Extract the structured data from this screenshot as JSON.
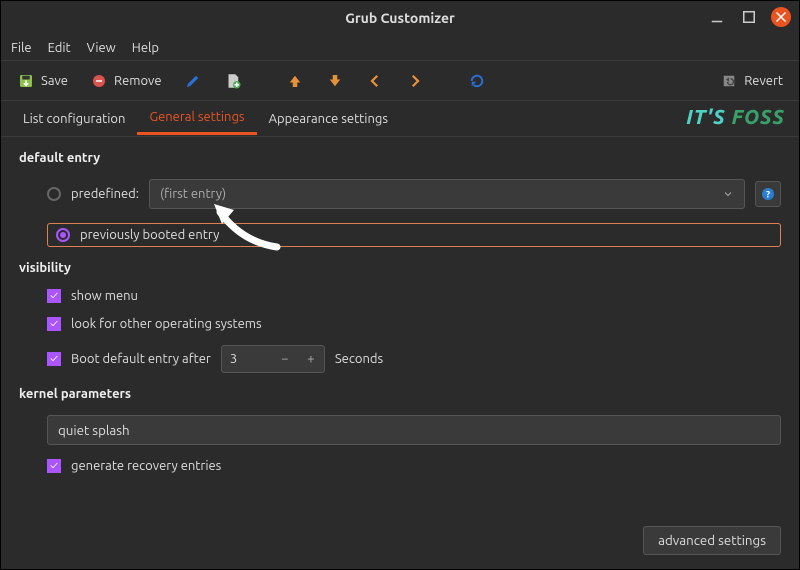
{
  "window": {
    "title": "Grub Customizer"
  },
  "menubar": [
    "File",
    "Edit",
    "View",
    "Help"
  ],
  "toolbar": {
    "save": "Save",
    "remove": "Remove",
    "revert": "Revert"
  },
  "tabs": {
    "list": "List configuration",
    "general": "General settings",
    "appearance": "Appearance settings",
    "active": "general"
  },
  "branding": {
    "its": "IT'S",
    "foss": "FOSS"
  },
  "default_entry": {
    "label": "default entry",
    "predefined_label": "predefined:",
    "predefined_value": "(first entry)",
    "previously_label": "previously booted entry",
    "selected": "previously"
  },
  "visibility": {
    "label": "visibility",
    "show_menu": "show menu",
    "look_for_os": "look for other operating systems",
    "boot_default_label": "Boot default entry after",
    "boot_default_value": "3",
    "seconds_label": "Seconds"
  },
  "kernel": {
    "label": "kernel parameters",
    "params": "quiet splash",
    "recovery_label": "generate recovery entries"
  },
  "advanced_label": "advanced settings"
}
